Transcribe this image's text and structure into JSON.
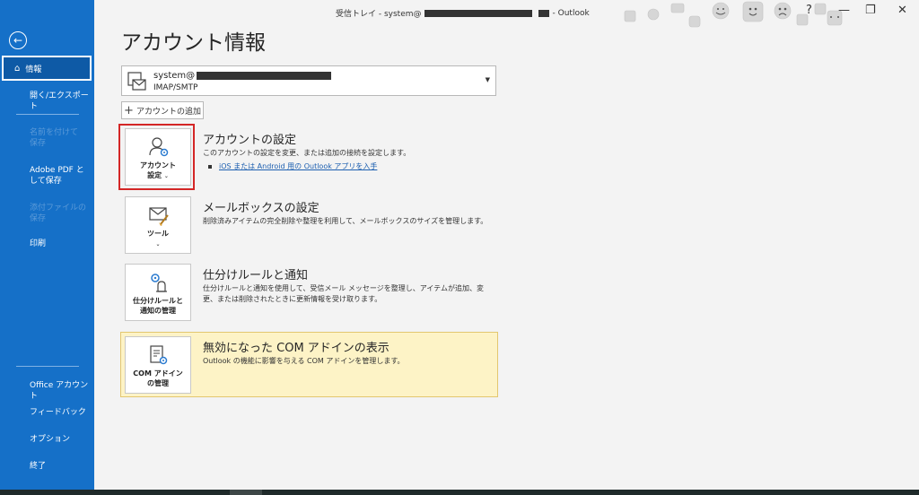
{
  "titlebar": {
    "prefix": "受信トレイ - system@",
    "suffix": "-  Outlook",
    "help": "?",
    "minimize": "—",
    "restore": "❐",
    "close": "✕"
  },
  "sidebar": {
    "back_icon": "←",
    "active": {
      "icon": "⌂",
      "label": "情報"
    },
    "items": [
      {
        "label": "開く/エクスポート"
      },
      {
        "label": "名前を付けて保存"
      },
      {
        "label": "Adobe PDF として保存"
      },
      {
        "label": "添付ファイルの保存"
      },
      {
        "label": "印刷"
      }
    ],
    "bottom_items": [
      {
        "label": "Office アカウント"
      },
      {
        "label": "フィードバック"
      },
      {
        "label": "オプション"
      },
      {
        "label": "終了"
      }
    ]
  },
  "main": {
    "title": "アカウント情報",
    "account": {
      "email_prefix": "system@",
      "type": "IMAP/SMTP",
      "dropdown_arrow": "▼"
    },
    "add_account": {
      "plus": "+",
      "label": "アカウントの追加"
    },
    "sections": {
      "account_settings": {
        "tile_label_1": "アカウント",
        "tile_label_2": "設定",
        "chevron": "⌄",
        "title": "アカウントの設定",
        "desc": "このアカウントの設定を変更、または追加の接続を設定します。",
        "link": "iOS または Android 用の Outlook アプリを入手"
      },
      "mailbox": {
        "tile_label": "ツール",
        "chevron": "⌄",
        "title": "メールボックスの設定",
        "desc": "削除済みアイテムの完全削除や整理を利用して、メールボックスのサイズを管理します。"
      },
      "rules": {
        "tile_label_1": "仕分けルールと",
        "tile_label_2": "通知の管理",
        "title": "仕分けルールと通知",
        "desc": "仕分けルールと通知を使用して、受信メール メッセージを整理し、アイテムが追加、変更、または削除されたときに更新情報を受け取ります。"
      },
      "com": {
        "tile_label_1": "COM アドイン",
        "tile_label_2": "の管理",
        "title": "無効になった COM アドインの表示",
        "desc": "Outlook の機能に影響を与える COM アドインを管理します。"
      }
    }
  },
  "colors": {
    "sidebar_bg": "#1570c8",
    "highlight_red": "#d42626",
    "com_panel_bg": "#fdf3c6",
    "link": "#1d5fb0"
  }
}
